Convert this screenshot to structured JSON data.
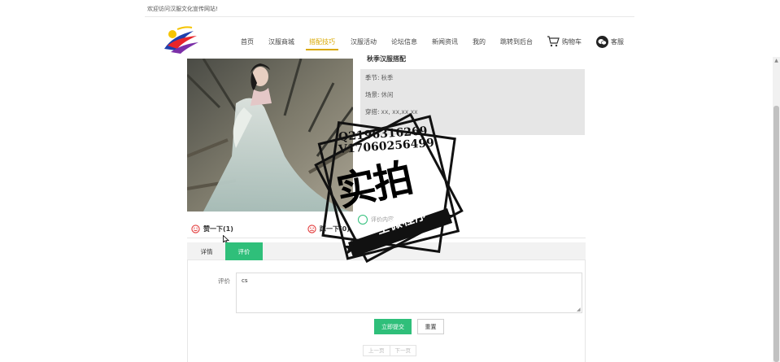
{
  "header": {
    "welcome": "欢迎访问汉服文化宣传网站!",
    "nav": [
      "首页",
      "汉服商城",
      "搭配技巧",
      "汉服活动",
      "论坛信息",
      "新闻资讯",
      "我的",
      "跳转到后台"
    ],
    "active_nav": "搭配技巧",
    "cart_label": "购物车",
    "service_label": "客服",
    "service_icon": "wechat-icon"
  },
  "product": {
    "title": "秋季汉服搭配",
    "season_label": "季节:",
    "season_value": "秋季",
    "scene_label": "场景:",
    "scene_value": "休闲",
    "extra_label": "穿搭:",
    "extra_value": "xx, xx,xx,xx"
  },
  "vote": {
    "like_label": "赞一下(1)",
    "dislike_label": "踩一下(0)",
    "comment_hint": "评价内容"
  },
  "tabs": [
    "详情",
    "评价"
  ],
  "active_tab": "评价",
  "review_form": {
    "label": "评价",
    "text_value": "cs",
    "submit_label": "立即提交",
    "reset_label": "重置"
  },
  "pager": {
    "prev_label": "上一页",
    "next_label": "下一页"
  },
  "watermark": {
    "line1": "Q2196316269",
    "line2": "V17060256499",
    "main": "实拍",
    "ribbon": "全微程序"
  },
  "colors": {
    "accent_green": "#2fbf7a",
    "active_nav": "#d9a800",
    "info_bg": "#e6e6e6"
  }
}
